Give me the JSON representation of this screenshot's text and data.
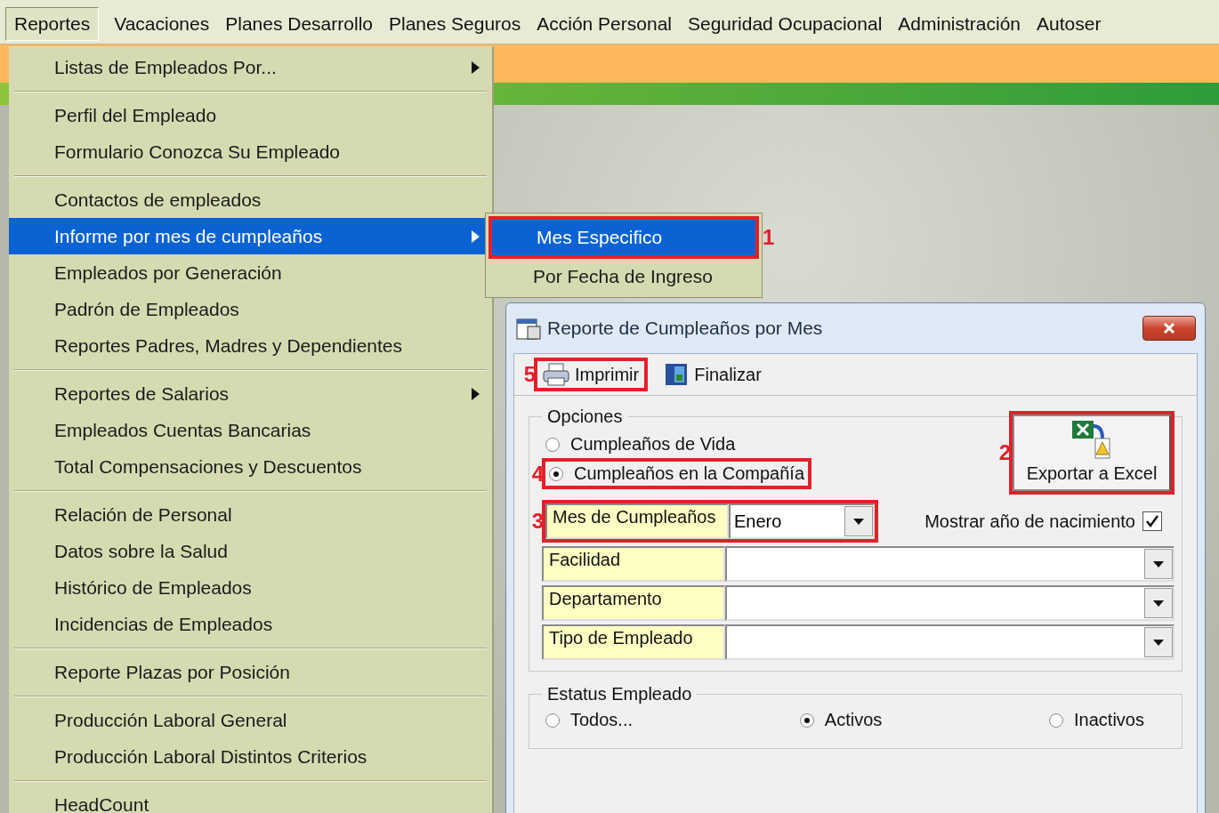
{
  "menubar": {
    "items": [
      {
        "label": "Reportes",
        "selected": true
      },
      {
        "label": "Vacaciones",
        "selected": false
      },
      {
        "label": "Planes Desarrollo",
        "selected": false
      },
      {
        "label": "Planes Seguros",
        "selected": false
      },
      {
        "label": "Acción Personal",
        "selected": false
      },
      {
        "label": "Seguridad Ocupacional",
        "selected": false
      },
      {
        "label": "Administración",
        "selected": false
      },
      {
        "label": "Autoser",
        "selected": false
      }
    ]
  },
  "menu": {
    "groups": [
      [
        {
          "label": "Listas de Empleados Por...",
          "submenu": true,
          "selected": false
        }
      ],
      [
        {
          "label": "Perfil del Empleado",
          "submenu": false,
          "selected": false
        },
        {
          "label": "Formulario Conozca Su Empleado",
          "submenu": false,
          "selected": false
        }
      ],
      [
        {
          "label": "Contactos de empleados",
          "submenu": false,
          "selected": false
        },
        {
          "label": "Informe por mes de cumpleaños",
          "submenu": true,
          "selected": true
        },
        {
          "label": "Empleados por Generación",
          "submenu": false,
          "selected": false
        },
        {
          "label": "Padrón de Empleados",
          "submenu": false,
          "selected": false
        },
        {
          "label": "Reportes Padres, Madres y Dependientes",
          "submenu": false,
          "selected": false
        }
      ],
      [
        {
          "label": "Reportes de Salarios",
          "submenu": true,
          "selected": false
        },
        {
          "label": "Empleados Cuentas Bancarias",
          "submenu": false,
          "selected": false
        },
        {
          "label": "Total Compensaciones y Descuentos",
          "submenu": false,
          "selected": false
        }
      ],
      [
        {
          "label": "Relación de Personal",
          "submenu": false,
          "selected": false
        },
        {
          "label": "Datos sobre la Salud",
          "submenu": false,
          "selected": false
        },
        {
          "label": "Histórico de Empleados",
          "submenu": false,
          "selected": false
        },
        {
          "label": "Incidencias de Empleados",
          "submenu": false,
          "selected": false
        }
      ],
      [
        {
          "label": "Reporte Plazas por Posición",
          "submenu": false,
          "selected": false
        }
      ],
      [
        {
          "label": "Producción Laboral General",
          "submenu": false,
          "selected": false
        },
        {
          "label": "Producción Laboral Distintos Criterios",
          "submenu": false,
          "selected": false
        }
      ],
      [
        {
          "label": "HeadCount",
          "submenu": false,
          "selected": false
        }
      ]
    ]
  },
  "submenu": {
    "items": [
      {
        "label": "Mes Especifico",
        "selected": true,
        "annotation": "1"
      },
      {
        "label": "Por Fecha de Ingreso",
        "selected": false
      }
    ]
  },
  "dialog": {
    "title": "Reporte de Cumpleaños por Mes",
    "toolbar": [
      {
        "kind": "print",
        "label": "Imprimir",
        "annotation": "5"
      },
      {
        "kind": "finish",
        "label": "Finalizar"
      }
    ],
    "options": {
      "legend": "Opciones",
      "radios": [
        {
          "label": "Cumpleaños de Vida",
          "selected": false
        },
        {
          "label": "Cumpleaños en la Compañía",
          "selected": true,
          "annotation": "4"
        }
      ]
    },
    "export_button": {
      "label": "Exportar a Excel",
      "annotation": "2"
    },
    "filters": [
      {
        "label": "Mes de Cumpleaños",
        "value": "Enero",
        "annotation": "3"
      },
      {
        "label": "Facilidad"
      },
      {
        "label": "Departamento"
      },
      {
        "label": "Tipo de Empleado"
      }
    ],
    "birth_year_checkbox": {
      "label": "Mostrar año de nacimiento",
      "checked": true
    },
    "status": {
      "legend": "Estatus Empleado",
      "radios": [
        {
          "label": "Todos...",
          "selected": false
        },
        {
          "label": "Activos",
          "selected": true
        },
        {
          "label": "Inactivos",
          "selected": false
        }
      ]
    }
  }
}
